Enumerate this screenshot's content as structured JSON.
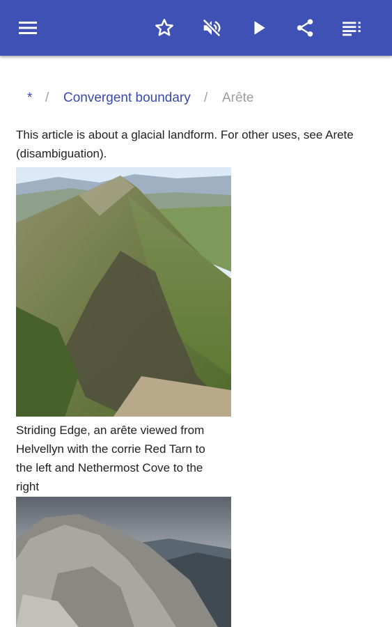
{
  "toolbar": {
    "menu_icon": "menu-icon",
    "actions": [
      "star-icon",
      "volume-off-icon",
      "play-icon",
      "share-icon",
      "contents-list-icon"
    ],
    "background_color": "#3f51b5"
  },
  "breadcrumb": {
    "home": "*",
    "separator": "/",
    "parent": "Convergent boundary",
    "current": "Arête"
  },
  "article": {
    "hatnote": "This article is about a glacial landform. For other uses, see Arete (disambiguation).",
    "figures": [
      {
        "caption": "Striding Edge, an arête viewed from Helvellyn with the corrie Red Tarn to the left and Nethermost Cove to the right"
      },
      {
        "caption": ""
      }
    ]
  }
}
